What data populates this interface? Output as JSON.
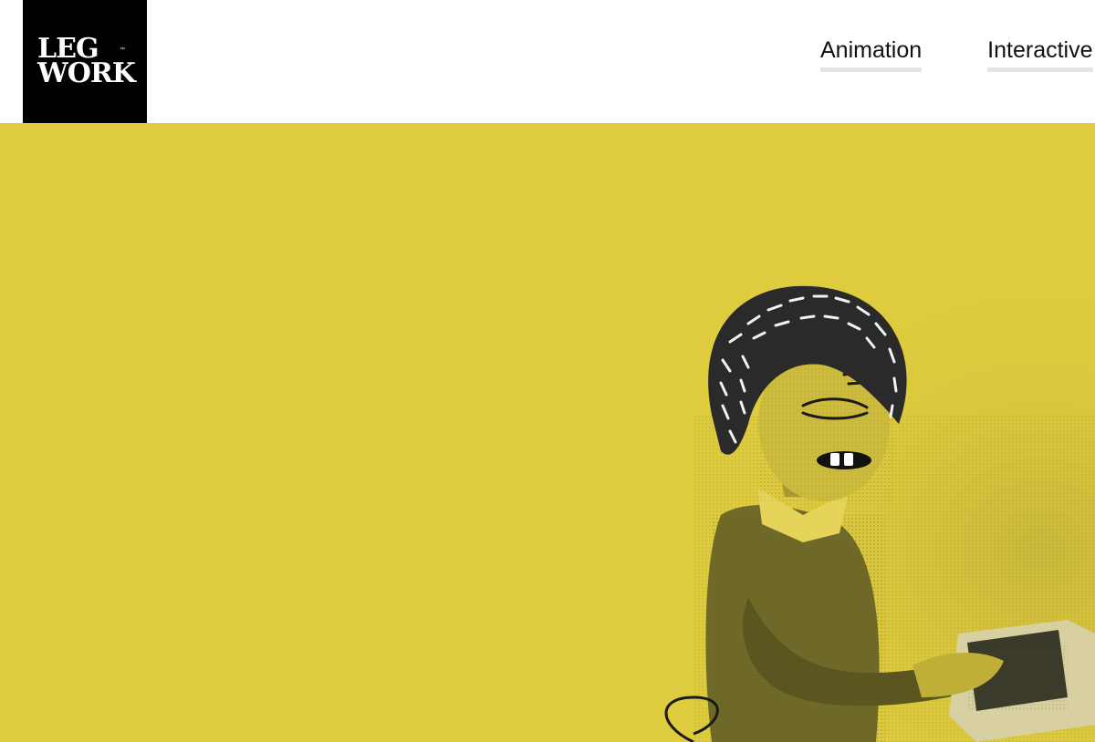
{
  "header": {
    "logo": {
      "line1": "LEG",
      "line2": "WORK",
      "tm": "™"
    },
    "nav": [
      {
        "label": "Animation"
      },
      {
        "label": "Interactive"
      }
    ]
  },
  "hero": {
    "background_color": "#decb3e",
    "image_subject": "halftone-photo-woman-typing-with-animated-face"
  }
}
